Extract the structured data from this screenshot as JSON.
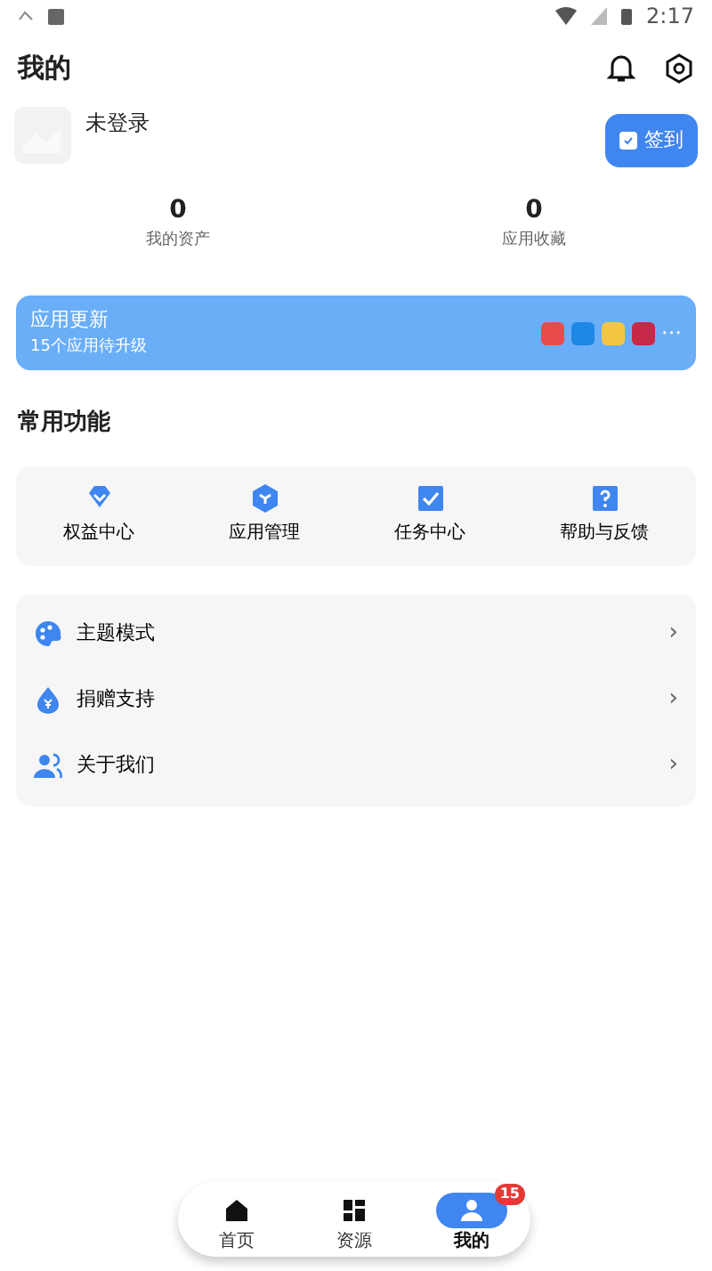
{
  "status_bar": {
    "time": "2:17"
  },
  "header": {
    "title": "我的"
  },
  "profile": {
    "name": "未登录",
    "checkin_button": "签到"
  },
  "stats": [
    {
      "value": "0",
      "label": "我的资产"
    },
    {
      "value": "0",
      "label": "应用收藏"
    }
  ],
  "update_banner": {
    "title": "应用更新",
    "subtitle": "15个应用待升级",
    "more": "···",
    "app_icons": [
      {
        "color": "#e94b4b"
      },
      {
        "color": "#1e88e5"
      },
      {
        "color": "#f4c542"
      },
      {
        "color": "#c62845"
      }
    ]
  },
  "common_functions": {
    "title": "常用功能",
    "items": [
      {
        "label": "权益中心",
        "kind": "diamond"
      },
      {
        "label": "应用管理",
        "kind": "hexagon"
      },
      {
        "label": "任务中心",
        "kind": "task"
      },
      {
        "label": "帮助与反馈",
        "kind": "help"
      }
    ]
  },
  "menu": [
    {
      "label": "主题模式",
      "kind": "palette",
      "chevron": "›"
    },
    {
      "label": "捐赠支持",
      "kind": "donate",
      "chevron": "›"
    },
    {
      "label": "关于我们",
      "kind": "people",
      "chevron": "›"
    }
  ],
  "bottom_nav": [
    {
      "label": "首页",
      "kind": "home",
      "selected": false
    },
    {
      "label": "资源",
      "kind": "grid",
      "selected": false
    },
    {
      "label": "我的",
      "kind": "user",
      "selected": true,
      "badge": "15"
    }
  ]
}
